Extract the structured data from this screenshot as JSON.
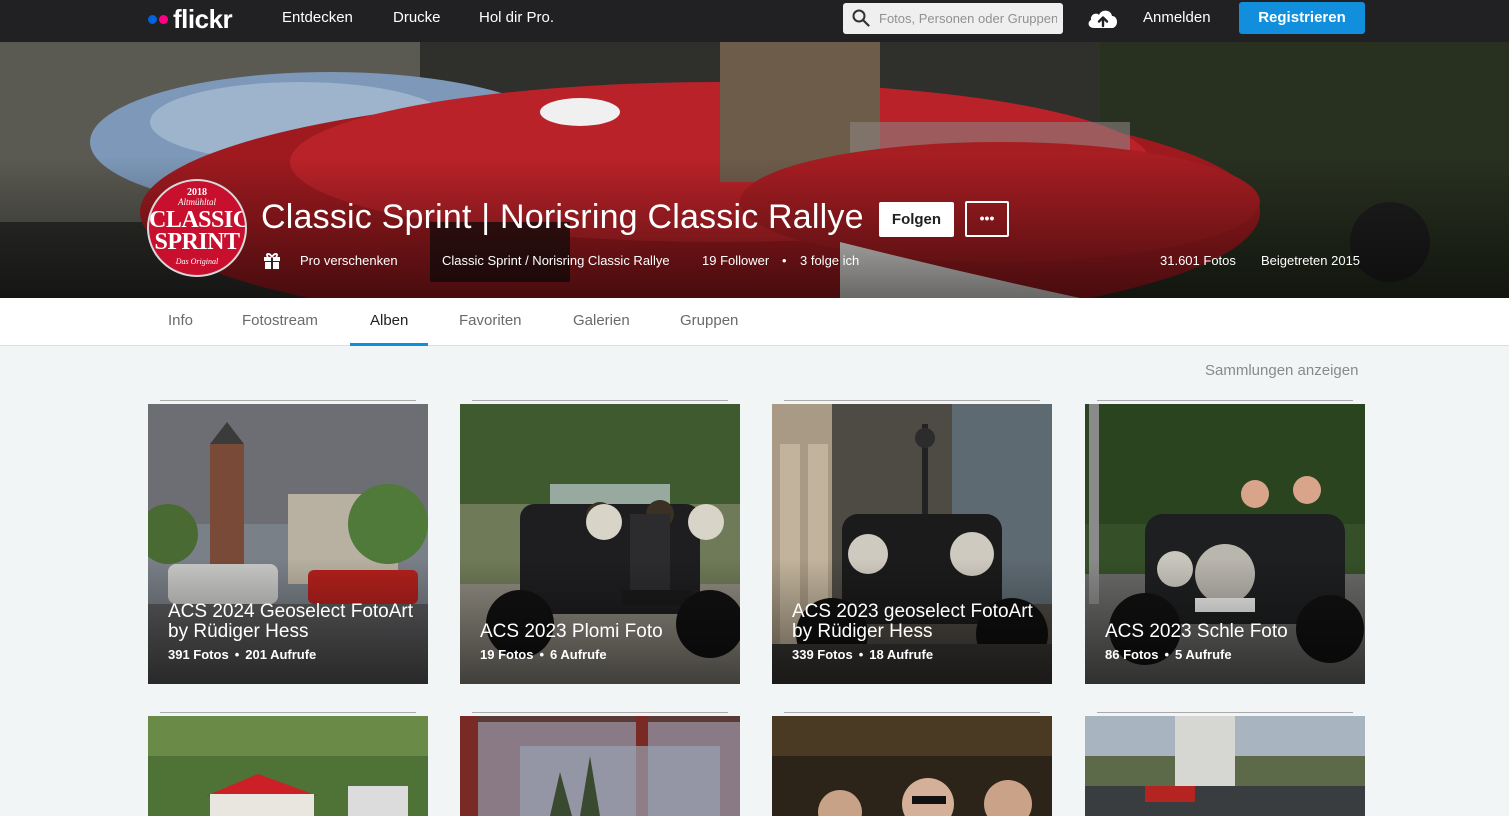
{
  "nav": {
    "logo": "flickr",
    "links": [
      "Entdecken",
      "Drucke",
      "Hol dir Pro."
    ],
    "search_placeholder": "Fotos, Personen oder Gruppen",
    "signin": "Anmelden",
    "register": "Registrieren"
  },
  "profile": {
    "title": "Classic Sprint | Norisring Classic Rallye",
    "follow_label": "Folgen",
    "more_label": "•••",
    "gift_label": "Pro verschenken",
    "name": "Classic Sprint / Norisring Classic Rallye",
    "followers": "19 Follower",
    "following": "3 folge ich",
    "photos": "31.601 Fotos",
    "joined": "Beigetreten 2015",
    "avatar": {
      "year": "2018",
      "sub": "Altmühltal",
      "line1": "CLASSIC",
      "line2": "SPRINT",
      "foot": "Das Original"
    }
  },
  "tabs": [
    {
      "label": "Info"
    },
    {
      "label": "Fotostream"
    },
    {
      "label": "Alben"
    },
    {
      "label": "Favoriten"
    },
    {
      "label": "Galerien"
    },
    {
      "label": "Gruppen"
    }
  ],
  "collections_link": "Sammlungen anzeigen",
  "albums": [
    {
      "title": "ACS 2024 Geoselect FotoArt by Rüdiger Hess",
      "photos": "391 Fotos",
      "views": "201 Aufrufe"
    },
    {
      "title": "ACS 2023 Plomi Foto",
      "photos": "19 Fotos",
      "views": "6 Aufrufe"
    },
    {
      "title": "ACS 2023 geoselect FotoArt by Rüdiger Hess",
      "photos": "339 Fotos",
      "views": "18 Aufrufe"
    },
    {
      "title": "ACS 2023 Schle Foto",
      "photos": "86 Fotos",
      "views": "5 Aufrufe"
    }
  ],
  "colors": {
    "nav_bg": "#212124",
    "register_bg": "#128fdc",
    "tab_active": "#128fdc",
    "page_bg": "#f2f5f6",
    "avatar_red": "#c8102e"
  }
}
